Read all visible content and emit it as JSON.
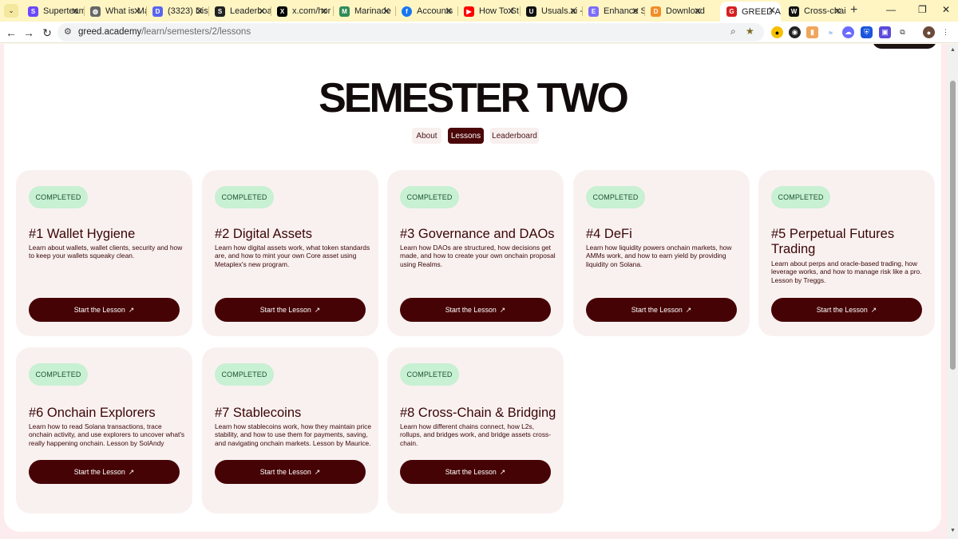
{
  "browser": {
    "tabs": [
      {
        "title": "Superteam",
        "icon": "superteam-icon",
        "color": "#6b48ff"
      },
      {
        "title": "What is Magic",
        "icon": "globe-icon",
        "color": "#555555"
      },
      {
        "title": "(3323) Dis",
        "icon": "discord-icon",
        "color": "#5865f2"
      },
      {
        "title": "Leaderboard",
        "icon": "leaderboard-icon",
        "color": "#222222"
      },
      {
        "title": "x.com/hor",
        "icon": "x-icon",
        "color": "#000000"
      },
      {
        "title": "Marinade",
        "icon": "marinade-icon",
        "color": "#2e8b57"
      },
      {
        "title": "Accounts",
        "icon": "facebook-icon",
        "color": "#1877f2"
      },
      {
        "title": "How To St",
        "icon": "youtube-icon",
        "color": "#ff0000"
      },
      {
        "title": "Usuals.ai -",
        "icon": "usuals-icon",
        "color": "#111111"
      },
      {
        "title": "Enhance S",
        "icon": "enhance-icon",
        "color": "#7c6cff"
      },
      {
        "title": "Download",
        "icon": "download-icon",
        "color": "#f28c28"
      },
      {
        "title": "GREED Ac",
        "icon": "greed-icon",
        "color": "#d42020"
      },
      {
        "title": "Cross-chai",
        "icon": "wormhole-icon",
        "color": "#111111"
      }
    ],
    "active_tab_index": 11,
    "url_host": "greed.academy",
    "url_path": "/learn/semesters/2/lessons"
  },
  "page": {
    "heading": "SEMESTER TWO",
    "nav": [
      "About",
      "Lessons",
      "Leaderboard"
    ],
    "active_nav": "Lessons",
    "accent_color": "#460305",
    "badge_color": "#c8f0d2"
  },
  "lessons": [
    {
      "status": "COMPLETED",
      "title": "#1 Wallet Hygiene",
      "description": "Learn about wallets, wallet clients, security and how to keep your wallets squeaky clean.",
      "button": "Start the Lesson"
    },
    {
      "status": "COMPLETED",
      "title": "#2 Digital Assets",
      "description": "Learn how digital assets work, what token standards are, and how to mint your own Core asset using Metaplex's new program.",
      "button": "Start the Lesson"
    },
    {
      "status": "COMPLETED",
      "title": "#3 Governance and DAOs",
      "description": "Learn how DAOs are structured, how decisions get made, and how to create your own onchain proposal using Realms.",
      "button": "Start the Lesson"
    },
    {
      "status": "COMPLETED",
      "title": "#4 DeFi",
      "description": "Learn how liquidity powers onchain markets, how AMMs work, and how to earn yield by providing liquidity on Solana.",
      "button": "Start the Lesson"
    },
    {
      "status": "COMPLETED",
      "title": "#5 Perpetual Futures Trading",
      "description": "Learn about perps and oracle-based trading, how leverage works, and how to manage risk like a pro. Lesson by Treggs.",
      "button": "Start the Lesson"
    },
    {
      "status": "COMPLETED",
      "title": "#6 Onchain Explorers",
      "description": "Learn how to read Solana transactions, trace onchain activity, and use explorers to uncover what's really happening onchain. Lesson by SolAndy",
      "button": "Start the Lesson"
    },
    {
      "status": "COMPLETED",
      "title": "#7 Stablecoins",
      "description": "Learn how stablecoins work, how they maintain price stability, and how to use them for payments, saving, and navigating onchain markets. Lesson by Maurice.",
      "button": "Start the Lesson"
    },
    {
      "status": "COMPLETED",
      "title": "#8 Cross-Chain & Bridging",
      "description": "Learn how different chains connect, how L2s, rollups, and bridges work, and bridge assets cross-chain.",
      "button": "Start the Lesson"
    }
  ]
}
